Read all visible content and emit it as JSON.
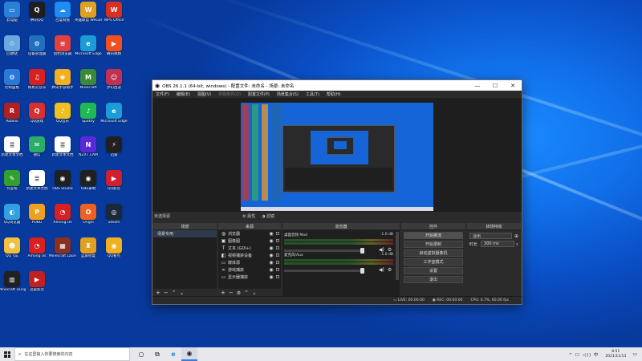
{
  "desktop": {
    "icons": [
      {
        "label": "此电脑",
        "color": "#2a80d8",
        "glyph": "▭"
      },
      {
        "label": "腾讯QQ",
        "color": "#1e1e1e",
        "glyph": "Q"
      },
      {
        "label": "百度网盘",
        "color": "#1e8cf0",
        "glyph": "☁"
      },
      {
        "label": "英雄联盟 WeGame",
        "color": "#e0a020",
        "glyph": "W"
      },
      {
        "label": "WPS Office",
        "color": "#d83020",
        "glyph": "W"
      },
      {
        "label": "回收站",
        "color": "#6aa8e0",
        "glyph": "♲"
      },
      {
        "label": "设备管理器",
        "color": "#2070c0",
        "glyph": "⚙"
      },
      {
        "label": "猎豹浏览器",
        "color": "#e04040",
        "glyph": "≡"
      },
      {
        "label": "Microsoft Edge",
        "color": "#1b9bd8",
        "glyph": "e"
      },
      {
        "label": "腾讯视频",
        "color": "#f05020",
        "glyph": "▶"
      },
      {
        "label": "控制面板",
        "color": "#2a78d8",
        "glyph": "⚙"
      },
      {
        "label": "网易云音乐",
        "color": "#d82020",
        "glyph": "♫"
      },
      {
        "label": "腾讯手游助手",
        "color": "#f0b020",
        "glyph": "♚"
      },
      {
        "label": "Minecraft",
        "color": "#3a8a3a",
        "glyph": "M"
      },
      {
        "label": "梦幻西游",
        "color": "#c03050",
        "glyph": "☺"
      },
      {
        "label": "Roblox",
        "color": "#b02020",
        "glyph": "R"
      },
      {
        "label": "QQ游戏",
        "color": "#d83030",
        "glyph": "Q"
      },
      {
        "label": "QQ音乐",
        "color": "#f0c020",
        "glyph": "♪"
      },
      {
        "label": "Spotify",
        "color": "#1db954",
        "glyph": "♪"
      },
      {
        "label": "Microsoft Edge",
        "color": "#1b9bd8",
        "glyph": "e"
      },
      {
        "label": "新建文本文档",
        "color": "#ffffff",
        "glyph": "≣"
      },
      {
        "label": "微信",
        "color": "#2aae67",
        "glyph": "✉"
      },
      {
        "label": "新建文本文档",
        "color": "#ffffff",
        "glyph": "≣"
      },
      {
        "label": "NZXT CAM",
        "color": "#5a2ad8",
        "glyph": "N"
      },
      {
        "label": "迅雷",
        "color": "#202020",
        "glyph": "⚡"
      },
      {
        "label": "作业帮",
        "color": "#30a030",
        "glyph": "✎"
      },
      {
        "label": "新建文本文档",
        "color": "#ffffff",
        "glyph": "≣"
      },
      {
        "label": "OBS Studio",
        "color": "#202020",
        "glyph": "◉"
      },
      {
        "label": "OBS录制",
        "color": "#202020",
        "glyph": "◉"
      },
      {
        "label": "QQ影音",
        "color": "#d02030",
        "glyph": "▶"
      },
      {
        "label": "QQ浏览器",
        "color": "#30a0e0",
        "glyph": "◐"
      },
      {
        "label": "PUBG",
        "color": "#f0a020",
        "glyph": "P"
      },
      {
        "label": "Among Us",
        "color": "#d82020",
        "glyph": "◔"
      },
      {
        "label": "Origin",
        "color": "#f06020",
        "glyph": "O"
      },
      {
        "label": "Steam",
        "color": "#1b2838",
        "glyph": "◎"
      },
      {
        "label": "QQ飞车",
        "color": "#f0c040",
        "glyph": "☻"
      },
      {
        "label": "Among Us",
        "color": "#d82020",
        "glyph": "◔"
      },
      {
        "label": "Minecraft Launcher",
        "color": "#8a3020",
        "glyph": "▦"
      },
      {
        "label": "蓝屏修复",
        "color": "#e0a020",
        "glyph": "♜"
      },
      {
        "label": "QQ看点",
        "color": "#f0b020",
        "glyph": "◉"
      },
      {
        "label": "Minecraft Dungeons",
        "color": "#202020",
        "glyph": "▥"
      },
      {
        "label": "迅雷影音",
        "color": "#c02020",
        "glyph": "▶"
      }
    ]
  },
  "obs": {
    "title": "OBS 26.1.1 (64-bit, windows) - 配置文件: 未命名 - 场景: 未命名",
    "window_buttons": [
      "—",
      "☐",
      "✕"
    ],
    "menu": [
      {
        "label": "文件(F)",
        "enabled": true
      },
      {
        "label": "编辑(E)",
        "enabled": true
      },
      {
        "label": "视图(V)",
        "enabled": true
      },
      {
        "label": "停靠部件(D)",
        "enabled": false
      },
      {
        "label": "配置文件(P)",
        "enabled": true
      },
      {
        "label": "场景集合(S)",
        "enabled": true
      },
      {
        "label": "工具(T)",
        "enabled": true
      },
      {
        "label": "帮助(H)",
        "enabled": true
      }
    ],
    "status_line": {
      "source": "未选择源",
      "properties": "⚙ 属性",
      "filters": "◑ 滤镜"
    },
    "docks": {
      "scenes": {
        "title": "场景",
        "items": [
          "场景专用"
        ]
      },
      "sources": {
        "title": "来源",
        "items": [
          {
            "icon": "◍",
            "name": "浏览器"
          },
          {
            "icon": "▣",
            "name": "图像图"
          },
          {
            "icon": "T",
            "name": "文本 (GDI+)"
          },
          {
            "icon": "◧",
            "name": "视频捕获设备"
          },
          {
            "icon": "▭",
            "name": "媒体源"
          },
          {
            "icon": "∞",
            "name": "游戏捕获"
          },
          {
            "icon": "▭",
            "name": "显示器捕获"
          }
        ]
      },
      "mixer": {
        "title": "混音器",
        "channels": [
          {
            "name": "桌面音频 Mod",
            "level": "-1.0 dB"
          },
          {
            "name": "麦克风/Aux",
            "level": "-1.0 dB"
          }
        ],
        "scale": [
          "-60",
          "-55",
          "-50",
          "-45",
          "-40",
          "-35",
          "-30",
          "-25",
          "-20",
          "-15",
          "-10",
          "-5",
          "0"
        ]
      },
      "controls": {
        "title": "控件",
        "buttons": [
          "开始推流",
          "开始录制",
          "启动虚拟摄像机",
          "工作室模式",
          "设置",
          "退出"
        ]
      },
      "transitions": {
        "title": "转场特效",
        "type": "淡出",
        "duration_label": "时长",
        "duration": "300 ms"
      }
    },
    "statusbar": {
      "live": "LIVE: 00:00:00",
      "rec": "REC: 00:00:00",
      "cpu": "CPU: 0.7%, 60.00 fps"
    }
  },
  "taskbar": {
    "search_placeholder": "在这里输入你要搜索的内容",
    "time": "8:51",
    "date": "2021/11/13",
    "tray": "^ ☐ ◁)) 中"
  }
}
